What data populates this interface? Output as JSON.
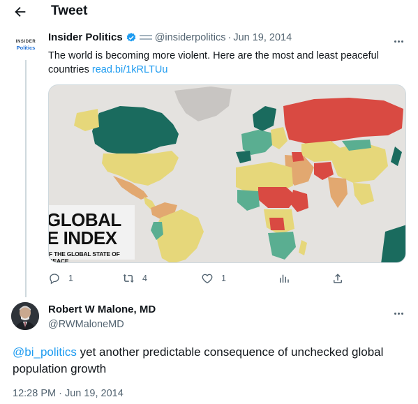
{
  "header": {
    "title": "Tweet"
  },
  "tweet": {
    "avatar_text_top": "INSIDER",
    "avatar_text_bottom": "Politics",
    "author_name": "Insider Politics",
    "handle": "@insiderpolitics",
    "separator": "·",
    "date": "Jun 19, 2014",
    "text": "The world is becoming more violent. Here are the most and least peaceful countries",
    "link": "read.bi/1kRLTUu",
    "image": {
      "title_line1": "GLOBAL",
      "title_line2": "E INDEX",
      "subtitle": "F THE GLOBAL STATE OF PEACE",
      "colors": {
        "very_peaceful": "#1a6b5e",
        "peaceful": "#5aae91",
        "medium": "#e6d77a",
        "low": "#e2a870",
        "very_low": "#d94a42",
        "no_data": "#c8c5c2",
        "ocean": "#e4e2df"
      }
    },
    "actions": {
      "replies": "1",
      "retweets": "4",
      "likes": "1"
    }
  },
  "reply": {
    "author_name": "Robert W Malone, MD",
    "handle": "@RWMaloneMD",
    "mention": "@bi_politics",
    "text": " yet another predictable consequence of unchecked global population growth",
    "timestamp": "12:28 PM · Jun 19, 2014"
  },
  "colors": {
    "link": "#1d9bf0",
    "muted": "#536471",
    "verified": "#1d9bf0"
  }
}
